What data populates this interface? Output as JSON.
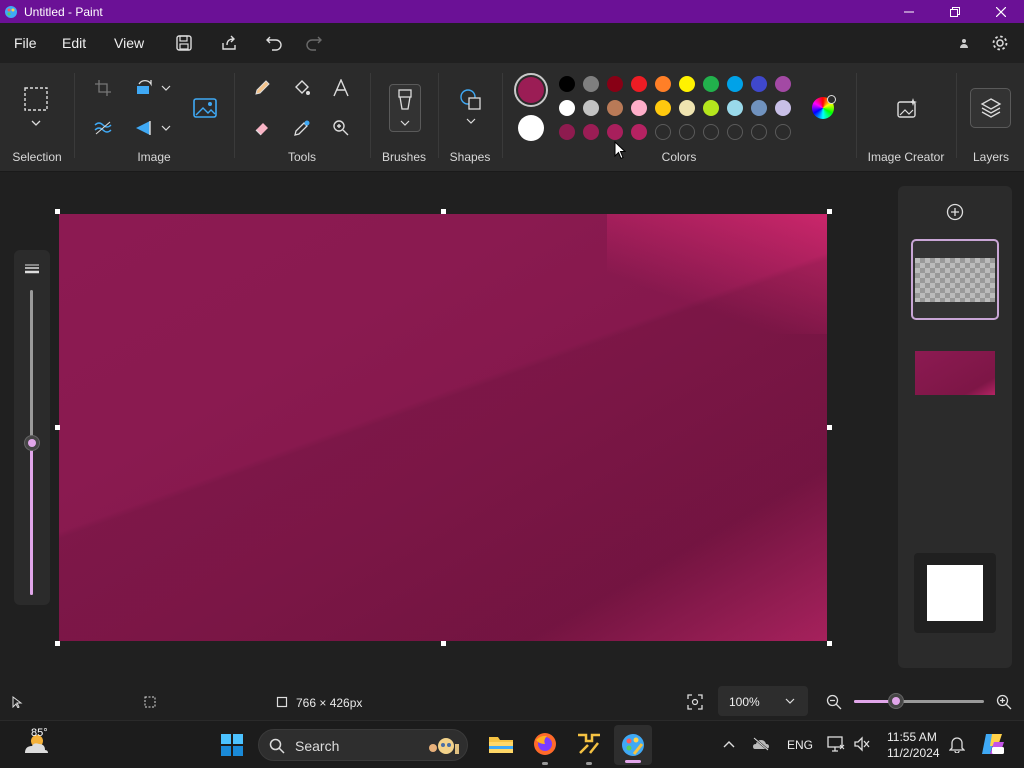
{
  "window": {
    "title": "Untitled - Paint"
  },
  "menu": {
    "file": "File",
    "edit": "Edit",
    "view": "View"
  },
  "ribbon": {
    "groups": {
      "selection": "Selection",
      "image": "Image",
      "tools": "Tools",
      "brushes": "Brushes",
      "shapes": "Shapes",
      "colors": "Colors",
      "image_creator": "Image Creator",
      "layers": "Layers"
    }
  },
  "colors": {
    "primary": "#9b1d55",
    "secondary": "#ffffff",
    "palette_row1": [
      "#000000",
      "#7f7f7f",
      "#880015",
      "#ed1c24",
      "#ff7f27",
      "#fff200",
      "#22b14c",
      "#00a2e8",
      "#3f48cc",
      "#a349a4"
    ],
    "palette_row2": [
      "#ffffff",
      "#c3c3c3",
      "#b97a57",
      "#ffaec9",
      "#ffc90e",
      "#efe4b0",
      "#b5e61d",
      "#99d9ea",
      "#7092be",
      "#c8bfe7"
    ],
    "custom_row3": [
      "#8e1b4f",
      "#9b1d55",
      "#a81f5c",
      "#b52262"
    ]
  },
  "status": {
    "canvas_size": "766 × 426px",
    "zoom": "100%",
    "zoom_level": 0.3
  },
  "taskbar": {
    "weather_temp": "85°",
    "search_label": "Search",
    "language": "ENG",
    "time": "11:55 AM",
    "date": "11/2/2024"
  },
  "brush_size_level": 0.5
}
